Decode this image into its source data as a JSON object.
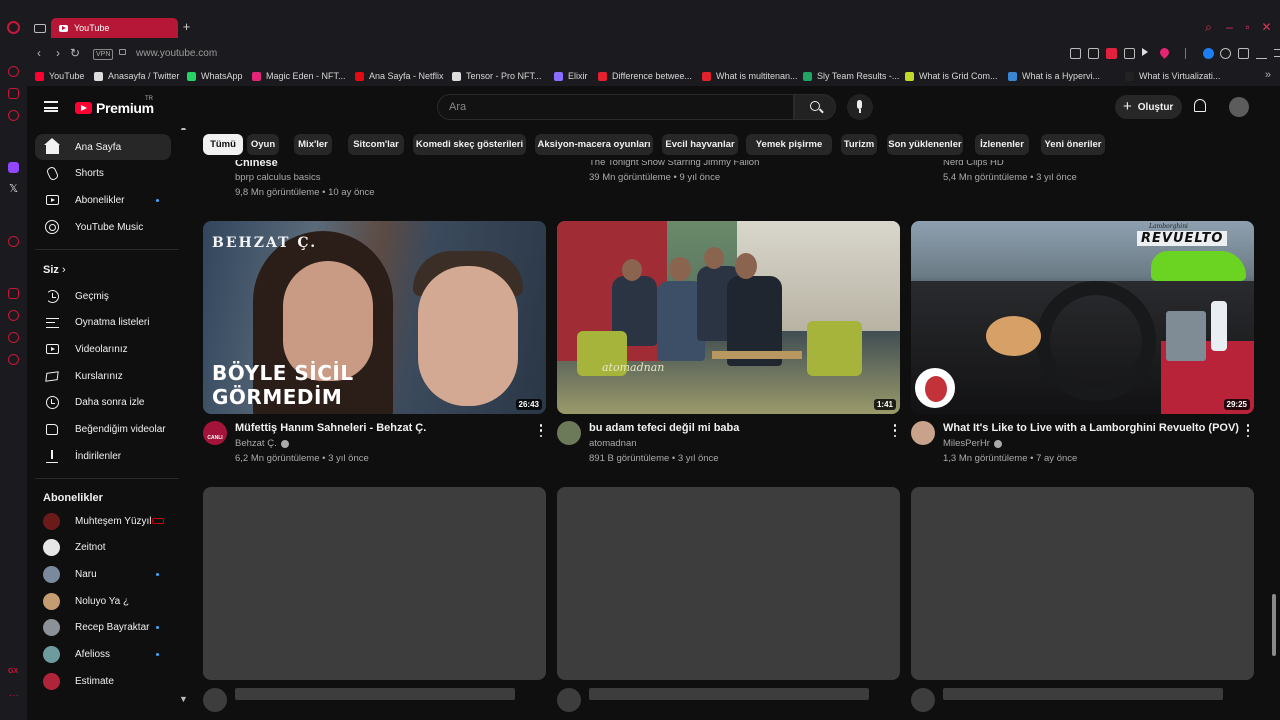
{
  "browser": {
    "active_tab_title": "YouTube",
    "url": "www.youtube.com",
    "vpn_label": "VPN",
    "bookmarks": [
      {
        "label": "YouTube",
        "color": "#ff0033"
      },
      {
        "label": "Anasayfa / Twitter",
        "color": "#dddddd"
      },
      {
        "label": "WhatsApp",
        "color": "#25d366"
      },
      {
        "label": "Magic Eden - NFT...",
        "color": "#e42575"
      },
      {
        "label": "Ana Sayfa - Netflix",
        "color": "#e50914"
      },
      {
        "label": "Tensor - Pro NFT...",
        "color": "#dddddd"
      },
      {
        "label": "Elixir",
        "color": "#8a6cff"
      },
      {
        "label": "Difference betwee...",
        "color": "#e3212d"
      },
      {
        "label": "What is multitenan...",
        "color": "#e3212d"
      },
      {
        "label": "Sly Team Results -...",
        "color": "#1fa463"
      },
      {
        "label": "What is Grid Com...",
        "color": "#c2d82a"
      },
      {
        "label": "What is a Hypervi...",
        "color": "#3a86d1"
      },
      {
        "label": "What is Virtualizati...",
        "color": "#222222"
      }
    ]
  },
  "masthead": {
    "logo_text": "Premium",
    "country_code": "TR",
    "search_placeholder": "Ara",
    "create_label": "Oluştur"
  },
  "sidebar": {
    "main": [
      {
        "label": "Ana Sayfa",
        "icon": "home-icon",
        "active": true
      },
      {
        "label": "Shorts",
        "icon": "shorts-icon"
      },
      {
        "label": "Abonelikler",
        "icon": "subscriptions-icon",
        "dot": true
      },
      {
        "label": "YouTube Music",
        "icon": "youtube-music-icon"
      }
    ],
    "you_header": "Siz",
    "you": [
      {
        "label": "Geçmiş",
        "icon": "history-icon"
      },
      {
        "label": "Oynatma listeleri",
        "icon": "playlists-icon"
      },
      {
        "label": "Videolarınız",
        "icon": "your-videos-icon"
      },
      {
        "label": "Kurslarınız",
        "icon": "courses-icon"
      },
      {
        "label": "Daha sonra izle",
        "icon": "watch-later-icon"
      },
      {
        "label": "Beğendiğim videolar",
        "icon": "liked-videos-icon"
      },
      {
        "label": "İndirilenler",
        "icon": "downloads-icon"
      }
    ],
    "subs_header": "Abonelikler",
    "subs": [
      {
        "label": "Muhteşem Yüzyıl",
        "color": "#6b1a1a",
        "live": true
      },
      {
        "label": "Zeitnot",
        "color": "#e6e6e6"
      },
      {
        "label": "Naru",
        "color": "#7a8a9c",
        "dot": true
      },
      {
        "label": "Noluyo Ya ¿",
        "color": "#c59b72"
      },
      {
        "label": "Recep Bayraktar",
        "color": "#8c9097",
        "dot": true
      },
      {
        "label": "Afelioss",
        "color": "#6e9c9e",
        "dot": true
      },
      {
        "label": "Estimate",
        "color": "#b0243a"
      }
    ]
  },
  "chips": [
    "Tümü",
    "Oyun",
    "Mix'ler",
    "Sitcom'lar",
    "Komedi skeç gösterileri",
    "Aksiyon-macera oyunları",
    "Evcil hayvanlar",
    "Yemek pişirme",
    "Turizm",
    "Son yüklenenler",
    "İzlenenler",
    "Yeni öneriler"
  ],
  "prev_row": [
    {
      "title": "Chinese",
      "channel": "bprp calculus basics",
      "stats": "9,8 Mn görüntüleme • 10 ay önce"
    },
    {
      "title": "",
      "channel": "The Tonight Show Starring Jimmy Fallon",
      "stats": "39 Mn görüntüleme • 9 yıl önce"
    },
    {
      "title": "",
      "channel": "Nerd Clips HD",
      "stats": "5,4 Mn görüntüleme • 3 yıl önce"
    }
  ],
  "videos": [
    {
      "title": "Müfettiş Hanım Sahneleri - Behzat Ç.",
      "channel": "Behzat Ç.",
      "stats": "6,2 Mn görüntüleme • 3 yıl önce",
      "duration": "26:43",
      "overlay_top": "BEHZAT Ç.",
      "overlay_big_1": "BÖYLE SİCİL",
      "overlay_big_2": "GÖRMEDİM",
      "avatar_label": "CANLI",
      "avatar_color": "#a4143a"
    },
    {
      "title": "bu adam tefeci değil mi baba",
      "channel": "atomadnan",
      "stats": "891 B görüntüleme • 3 yıl önce",
      "duration": "1:41",
      "watermark": "atomadnan",
      "avatar_color": "#6c7a5a"
    },
    {
      "title": "What It's Like to Live with a Lamborghini Revuelto (POV)",
      "channel": "MilesPerHr",
      "stats": "1,3 Mn görüntüleme • 7 ay önce",
      "duration": "29:25",
      "brand": "Lamborghini",
      "model": "REVUELTO",
      "avatar_color": "#c8a28a"
    }
  ]
}
